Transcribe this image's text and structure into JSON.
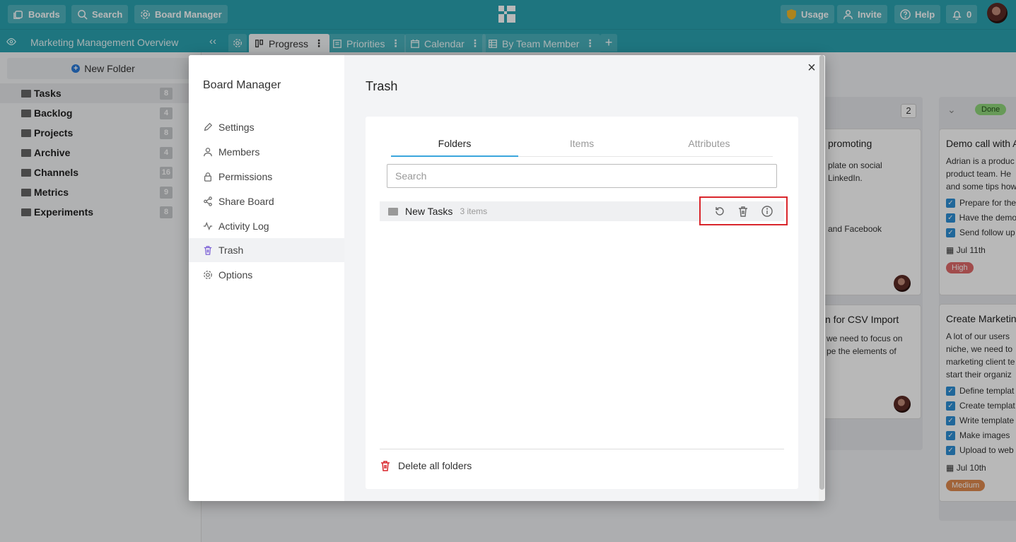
{
  "topbar": {
    "boards_label": "Boards",
    "search_label": "Search",
    "board_manager_label": "Board Manager",
    "usage_label": "Usage",
    "invite_label": "Invite",
    "help_label": "Help",
    "notification_count": "0"
  },
  "subbar": {
    "board_title": "Marketing Management Overview",
    "views": [
      {
        "label": "Progress"
      },
      {
        "label": "Priorities"
      },
      {
        "label": "Calendar"
      },
      {
        "label": "By Team Member"
      }
    ]
  },
  "sidebar": {
    "new_folder_label": "New Folder",
    "folders": [
      {
        "name": "Tasks",
        "count": "8"
      },
      {
        "name": "Backlog",
        "count": "4"
      },
      {
        "name": "Projects",
        "count": "8"
      },
      {
        "name": "Archive",
        "count": "4"
      },
      {
        "name": "Channels",
        "count": "16"
      },
      {
        "name": "Metrics",
        "count": "9"
      },
      {
        "name": "Experiments",
        "count": "8"
      }
    ]
  },
  "board": {
    "col2_count": "2",
    "card1": {
      "title_partial": "promoting",
      "line1": "plate on social",
      "line2": "LinkedIn.",
      "line3": "and Facebook"
    },
    "card2": {
      "title_partial": "n for CSV Import",
      "line1": "we need to focus on",
      "line2": "pe the elements of"
    },
    "done_label": "Done",
    "card3": {
      "title": "Demo call with A",
      "lines": [
        "Adrian is a produc",
        "product team. He",
        "and some tips how"
      ],
      "checks": [
        "Prepare for the",
        "Have the demo",
        "Send follow up"
      ],
      "date": "Jul 11th",
      "tag": "High"
    },
    "card4": {
      "title": "Create Marketin",
      "lines": [
        "A lot of our users",
        "niche, we need to",
        "marketing client te",
        "start their organiz"
      ],
      "checks": [
        "Define templat",
        "Create templat",
        "Write template",
        "Make images",
        "Upload to web"
      ],
      "date": "Jul 10th",
      "tag": "Medium"
    }
  },
  "modal": {
    "title": "Board Manager",
    "nav": [
      {
        "label": "Settings"
      },
      {
        "label": "Members"
      },
      {
        "label": "Permissions"
      },
      {
        "label": "Share Board"
      },
      {
        "label": "Activity Log"
      },
      {
        "label": "Trash"
      },
      {
        "label": "Options"
      }
    ],
    "main_title": "Trash",
    "tabs": [
      {
        "label": "Folders"
      },
      {
        "label": "Items"
      },
      {
        "label": "Attributes"
      }
    ],
    "search_placeholder": "Search",
    "trash_items": [
      {
        "name": "New Tasks",
        "count": "3 items"
      }
    ],
    "delete_all_label": "Delete all folders"
  },
  "colors": {
    "topbar": "#2aa3b0",
    "active_tab_underline": "#3ba6dd",
    "highlight_box": "#d9262c",
    "trash_icon_active": "#7b5fd6"
  }
}
